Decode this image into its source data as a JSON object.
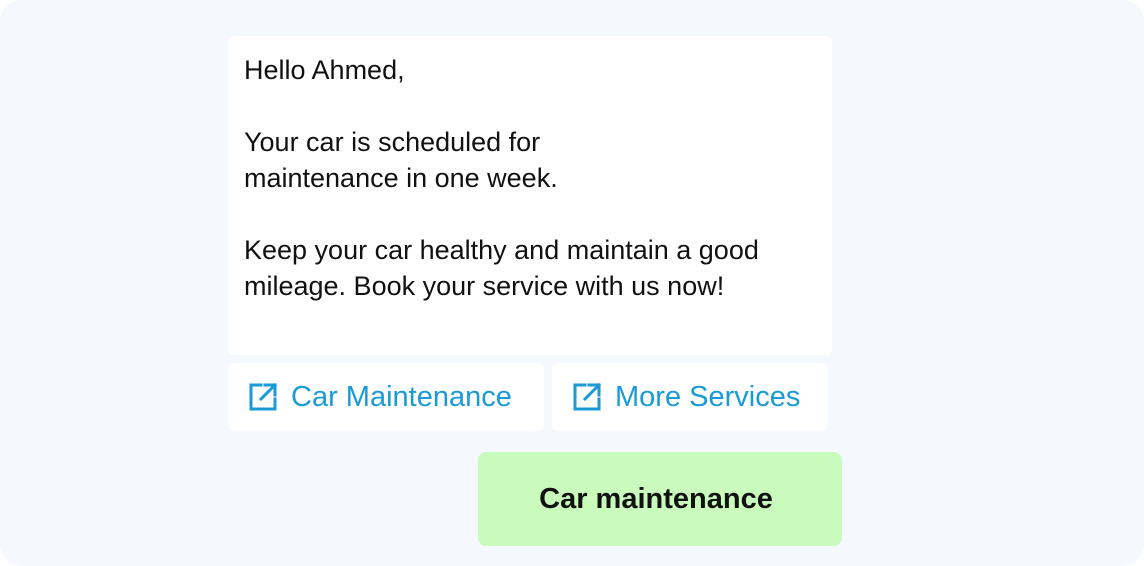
{
  "message": {
    "greeting": "Hello Ahmed,",
    "paragraph1": "Your car is scheduled for maintenance in one week.",
    "paragraph2": "Keep your car healthy and maintain a good mileage. Book your service with us now!"
  },
  "actions": [
    {
      "label": "Car Maintenance",
      "icon": "external-link-icon"
    },
    {
      "label": "More Services",
      "icon": "external-link-icon"
    }
  ],
  "reply": {
    "text": "Car maintenance"
  },
  "colors": {
    "background": "#f5f8fe",
    "bubble": "#ffffff",
    "link": "#1a9ad6",
    "reply_bubble": "#c9fbbd"
  }
}
